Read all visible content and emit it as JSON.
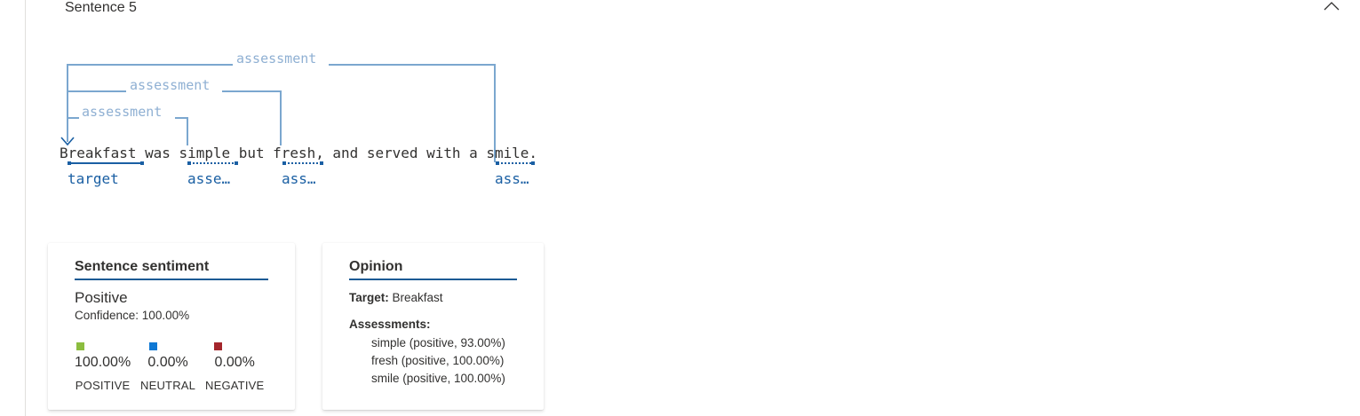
{
  "section": {
    "title": "Sentence 5"
  },
  "arcs": {
    "labels": [
      "assessment",
      "assessment",
      "assessment"
    ]
  },
  "sentence": {
    "text": "Breakfast was simple but fresh, and served with a smile.",
    "roles": {
      "target": "target",
      "simple": "asse…",
      "fresh": "ass…",
      "smile": "ass…"
    }
  },
  "sentiment_card": {
    "heading": "Sentence sentiment",
    "label": "Positive",
    "confidence": "Confidence: 100.00%",
    "scores": [
      {
        "value": "100.00%",
        "name": "POSITIVE",
        "color": "#8cbd3f"
      },
      {
        "value": "0.00%",
        "name": "NEUTRAL",
        "color": "#0f78d4"
      },
      {
        "value": "0.00%",
        "name": "NEGATIVE",
        "color": "#a4262c"
      }
    ]
  },
  "opinion_card": {
    "heading": "Opinion",
    "target_label": "Target:",
    "target_value": "Breakfast",
    "assessments_label": "Assessments:",
    "assessments": [
      "simple (positive, 93.00%)",
      "fresh (positive, 100.00%)",
      "smile (positive, 100.00%)"
    ]
  },
  "colors": {
    "arc": "#8fb0d3",
    "role": "#1a5fa3",
    "heading_underline": "#1c5a94"
  },
  "icons": {
    "collapse": "chevron-up-icon",
    "arrow": "arrow-down-icon"
  }
}
